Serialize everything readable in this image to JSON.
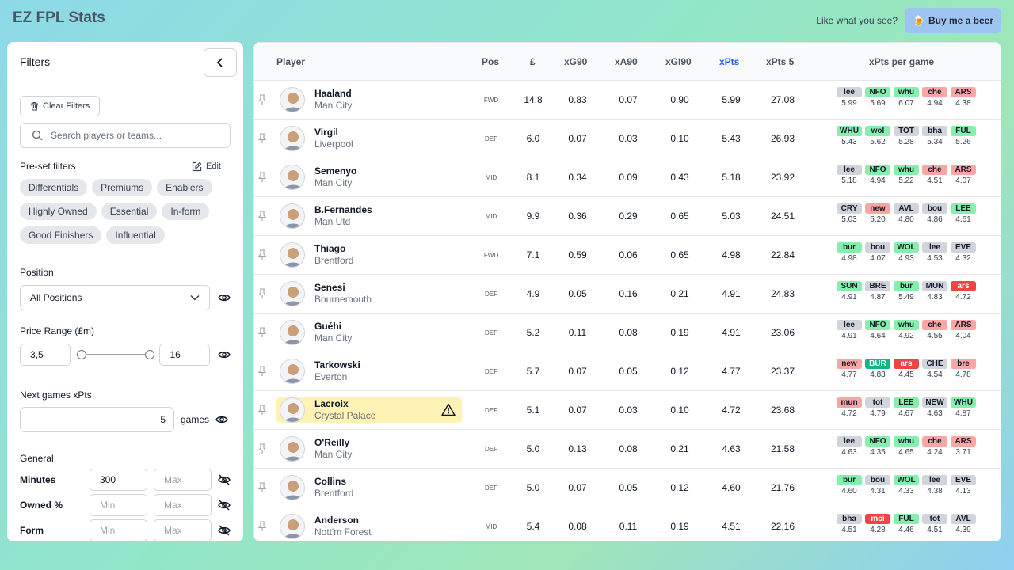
{
  "app": {
    "title": "EZ FPL Stats",
    "like_text": "Like what you see?",
    "beer_label": "Buy me a beer",
    "beer_emoji": "🍺"
  },
  "filters": {
    "title": "Filters",
    "clear_label": "Clear Filters",
    "search_placeholder": "Search players or teams...",
    "preset_label": "Pre-set filters",
    "edit_label": "Edit",
    "presets": [
      "Differentials",
      "Premiums",
      "Enablers",
      "Highly Owned",
      "Essential",
      "In-form",
      "Good Finishers",
      "Influential"
    ],
    "position_label": "Position",
    "position_value": "All Positions",
    "price_label": "Price Range (£m)",
    "price_min": "3,5",
    "price_max": "16",
    "price_fraction": [
      0,
      1
    ],
    "next_games_label": "Next games xPts",
    "next_games_value": "5",
    "games_suffix": "games",
    "general_label": "General",
    "general": [
      {
        "label": "Minutes",
        "min": "300",
        "max": "Max"
      },
      {
        "label": "Owned %",
        "min": "Min",
        "max": "Max"
      },
      {
        "label": "Form",
        "min": "Min",
        "max": "Max"
      }
    ]
  },
  "table": {
    "headers": {
      "player": "Player",
      "pos": "Pos",
      "price": "£",
      "xg90": "xG90",
      "xa90": "xA90",
      "xgi90": "xGI90",
      "xpts": "xPts",
      "xpts5": "xPts 5",
      "per_game": "xPts per game"
    },
    "accent": "#2563eb",
    "rows": [
      {
        "name": "Haaland",
        "team": "Man City",
        "pos": "FWD",
        "price": "14.8",
        "xg90": "0.83",
        "xa90": "0.07",
        "xgi90": "0.90",
        "xpts": "5.99",
        "xpts5": "27.08",
        "fixtures": [
          {
            "opp": "lee",
            "xp": "5.99",
            "d": 3
          },
          {
            "opp": "NFO",
            "xp": "5.69",
            "d": 2
          },
          {
            "opp": "whu",
            "xp": "6.07",
            "d": 2
          },
          {
            "opp": "che",
            "xp": "4.94",
            "d": 4
          },
          {
            "opp": "ARS",
            "xp": "4.38",
            "d": 4
          }
        ]
      },
      {
        "name": "Virgil",
        "team": "Liverpool",
        "pos": "DEF",
        "price": "6.0",
        "xg90": "0.07",
        "xa90": "0.03",
        "xgi90": "0.10",
        "xpts": "5.43",
        "xpts5": "26.93",
        "fixtures": [
          {
            "opp": "WHU",
            "xp": "5.43",
            "d": 2
          },
          {
            "opp": "wol",
            "xp": "5.62",
            "d": 2
          },
          {
            "opp": "TOT",
            "xp": "5.28",
            "d": 3
          },
          {
            "opp": "bha",
            "xp": "5.34",
            "d": 3
          },
          {
            "opp": "FUL",
            "xp": "5.26",
            "d": 2
          }
        ]
      },
      {
        "name": "Semenyo",
        "team": "Man City",
        "pos": "MID",
        "price": "8.1",
        "xg90": "0.34",
        "xa90": "0.09",
        "xgi90": "0.43",
        "xpts": "5.18",
        "xpts5": "23.92",
        "fixtures": [
          {
            "opp": "lee",
            "xp": "5.18",
            "d": 3
          },
          {
            "opp": "NFO",
            "xp": "4.94",
            "d": 2
          },
          {
            "opp": "whu",
            "xp": "5.22",
            "d": 2
          },
          {
            "opp": "che",
            "xp": "4.51",
            "d": 4
          },
          {
            "opp": "ARS",
            "xp": "4.07",
            "d": 4
          }
        ]
      },
      {
        "name": "B.Fernandes",
        "team": "Man Utd",
        "pos": "MID",
        "price": "9.9",
        "xg90": "0.36",
        "xa90": "0.29",
        "xgi90": "0.65",
        "xpts": "5.03",
        "xpts5": "24.51",
        "fixtures": [
          {
            "opp": "CRY",
            "xp": "5.03",
            "d": 3
          },
          {
            "opp": "new",
            "xp": "5.20",
            "d": 4
          },
          {
            "opp": "AVL",
            "xp": "4.80",
            "d": 3
          },
          {
            "opp": "bou",
            "xp": "4.86",
            "d": 3
          },
          {
            "opp": "LEE",
            "xp": "4.61",
            "d": 2
          }
        ]
      },
      {
        "name": "Thiago",
        "team": "Brentford",
        "pos": "FWD",
        "price": "7.1",
        "xg90": "0.59",
        "xa90": "0.06",
        "xgi90": "0.65",
        "xpts": "4.98",
        "xpts5": "22.84",
        "fixtures": [
          {
            "opp": "bur",
            "xp": "4.98",
            "d": 2
          },
          {
            "opp": "bou",
            "xp": "4.07",
            "d": 3
          },
          {
            "opp": "WOL",
            "xp": "4.93",
            "d": 2
          },
          {
            "opp": "lee",
            "xp": "4.53",
            "d": 3
          },
          {
            "opp": "EVE",
            "xp": "4.32",
            "d": 3
          }
        ]
      },
      {
        "name": "Senesi",
        "team": "Bournemouth",
        "pos": "DEF",
        "price": "4.9",
        "xg90": "0.05",
        "xa90": "0.16",
        "xgi90": "0.21",
        "xpts": "4.91",
        "xpts5": "24.83",
        "fixtures": [
          {
            "opp": "SUN",
            "xp": "4.91",
            "d": 2
          },
          {
            "opp": "BRE",
            "xp": "4.87",
            "d": 3
          },
          {
            "opp": "bur",
            "xp": "5.49",
            "d": 2
          },
          {
            "opp": "MUN",
            "xp": "4.83",
            "d": 3
          },
          {
            "opp": "ars",
            "xp": "4.72",
            "d": 5
          }
        ]
      },
      {
        "name": "Guéhi",
        "team": "Man City",
        "pos": "DEF",
        "price": "5.2",
        "xg90": "0.11",
        "xa90": "0.08",
        "xgi90": "0.19",
        "xpts": "4.91",
        "xpts5": "23.06",
        "fixtures": [
          {
            "opp": "lee",
            "xp": "4.91",
            "d": 3
          },
          {
            "opp": "NFO",
            "xp": "4.64",
            "d": 2
          },
          {
            "opp": "whu",
            "xp": "4.92",
            "d": 2
          },
          {
            "opp": "che",
            "xp": "4.55",
            "d": 4
          },
          {
            "opp": "ARS",
            "xp": "4.04",
            "d": 4
          }
        ]
      },
      {
        "name": "Tarkowski",
        "team": "Everton",
        "pos": "DEF",
        "price": "5.7",
        "xg90": "0.07",
        "xa90": "0.05",
        "xgi90": "0.12",
        "xpts": "4.77",
        "xpts5": "23.37",
        "fixtures": [
          {
            "opp": "new",
            "xp": "4.77",
            "d": 4
          },
          {
            "opp": "BUR",
            "xp": "4.83",
            "d": 1
          },
          {
            "opp": "ars",
            "xp": "4.45",
            "d": 5
          },
          {
            "opp": "CHE",
            "xp": "4.54",
            "d": 3
          },
          {
            "opp": "bre",
            "xp": "4.78",
            "d": 4
          }
        ]
      },
      {
        "name": "Lacroix",
        "team": "Crystal Palace",
        "pos": "DEF",
        "price": "5.1",
        "xg90": "0.07",
        "xa90": "0.03",
        "xgi90": "0.10",
        "xpts": "4.72",
        "xpts5": "23.68",
        "highlight": true,
        "fixtures": [
          {
            "opp": "mun",
            "xp": "4.72",
            "d": 4
          },
          {
            "opp": "tot",
            "xp": "4.79",
            "d": 3
          },
          {
            "opp": "LEE",
            "xp": "4.67",
            "d": 2
          },
          {
            "opp": "NEW",
            "xp": "4.63",
            "d": 3
          },
          {
            "opp": "WHU",
            "xp": "4.87",
            "d": 2
          }
        ]
      },
      {
        "name": "O'Reilly",
        "team": "Man City",
        "pos": "DEF",
        "price": "5.0",
        "xg90": "0.13",
        "xa90": "0.08",
        "xgi90": "0.21",
        "xpts": "4.63",
        "xpts5": "21.58",
        "fixtures": [
          {
            "opp": "lee",
            "xp": "4.63",
            "d": 3
          },
          {
            "opp": "NFO",
            "xp": "4.35",
            "d": 2
          },
          {
            "opp": "whu",
            "xp": "4.65",
            "d": 2
          },
          {
            "opp": "che",
            "xp": "4.24",
            "d": 4
          },
          {
            "opp": "ARS",
            "xp": "3.71",
            "d": 4
          }
        ]
      },
      {
        "name": "Collins",
        "team": "Brentford",
        "pos": "DEF",
        "price": "5.0",
        "xg90": "0.07",
        "xa90": "0.05",
        "xgi90": "0.12",
        "xpts": "4.60",
        "xpts5": "21.76",
        "fixtures": [
          {
            "opp": "bur",
            "xp": "4.60",
            "d": 2
          },
          {
            "opp": "bou",
            "xp": "4.31",
            "d": 3
          },
          {
            "opp": "WOL",
            "xp": "4.33",
            "d": 2
          },
          {
            "opp": "lee",
            "xp": "4.38",
            "d": 3
          },
          {
            "opp": "EVE",
            "xp": "4.13",
            "d": 3
          }
        ]
      },
      {
        "name": "Anderson",
        "team": "Nott'm Forest",
        "pos": "MID",
        "price": "5.4",
        "xg90": "0.08",
        "xa90": "0.11",
        "xgi90": "0.19",
        "xpts": "4.51",
        "xpts5": "22.16",
        "fixtures": [
          {
            "opp": "bha",
            "xp": "4.51",
            "d": 3
          },
          {
            "opp": "mci",
            "xp": "4.28",
            "d": 5
          },
          {
            "opp": "FUL",
            "xp": "4.46",
            "d": 2
          },
          {
            "opp": "tot",
            "xp": "4.51",
            "d": 3
          },
          {
            "opp": "AVL",
            "xp": "4.39",
            "d": 3
          }
        ]
      }
    ]
  }
}
